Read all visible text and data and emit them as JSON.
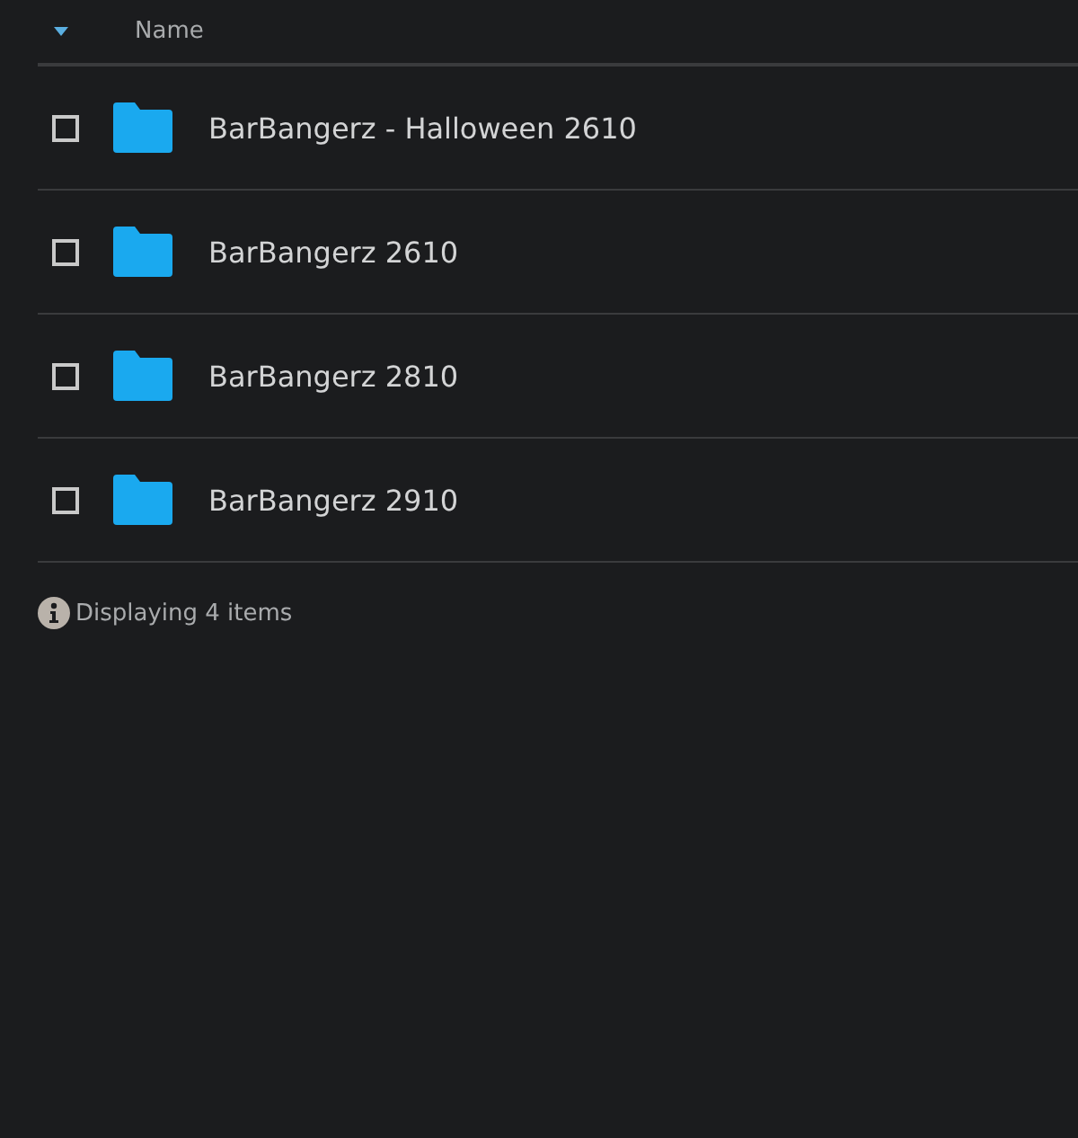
{
  "table": {
    "columns": [
      {
        "label": "Name",
        "sorted": true
      }
    ],
    "rows": [
      {
        "name": "BarBangerz - Halloween 2610",
        "checked": false
      },
      {
        "name": "BarBangerz 2610",
        "checked": false
      },
      {
        "name": "BarBangerz 2810",
        "checked": false
      },
      {
        "name": "BarBangerz 2910",
        "checked": false
      }
    ]
  },
  "status_bar": {
    "text": "Displaying 4 items"
  }
}
